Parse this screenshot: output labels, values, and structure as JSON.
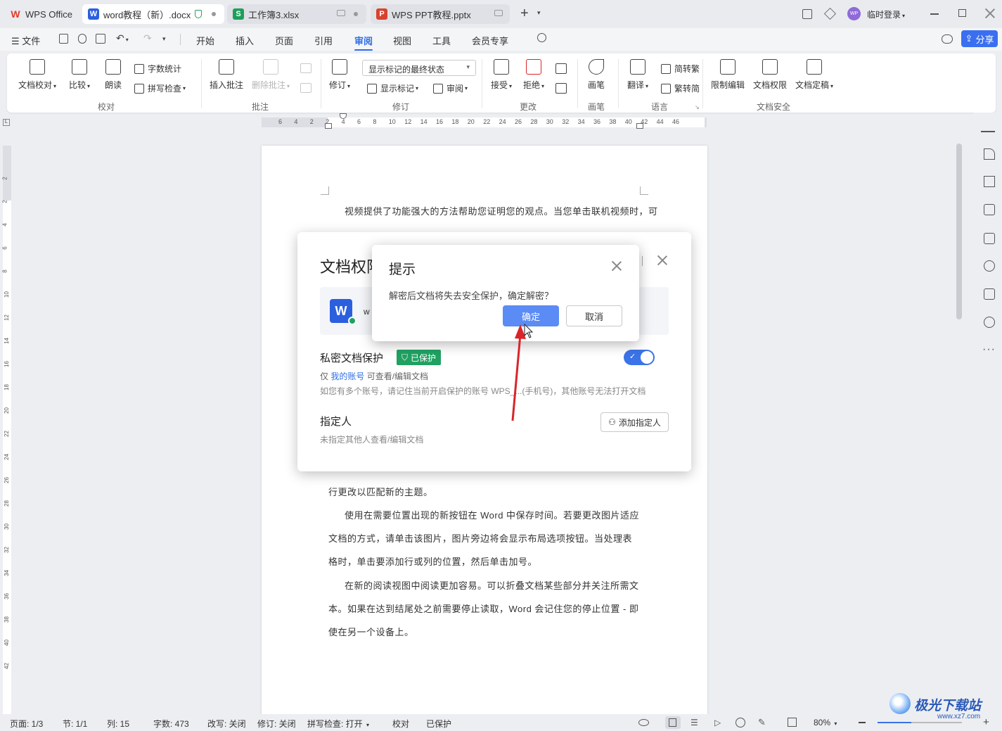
{
  "tabs": [
    {
      "label": "WPS Office",
      "icon": "wps-logo-icon"
    },
    {
      "label": "word教程（新）.docx",
      "icon": "word-doc-icon"
    },
    {
      "label": "工作簿3.xlsx",
      "icon": "sheet-icon"
    },
    {
      "label": "WPS PPT教程.pptx",
      "icon": "ppt-icon"
    }
  ],
  "titlebar": {
    "login_label": "临时登录",
    "avatar_text": "WP"
  },
  "menubar": {
    "file": "文件",
    "items": [
      "开始",
      "插入",
      "页面",
      "引用",
      "审阅",
      "视图",
      "工具",
      "会员专享"
    ],
    "active": "审阅",
    "share": "分享"
  },
  "ribbon": {
    "proof": {
      "doc_check": "文档校对",
      "compare": "比较",
      "read_aloud": "朗读",
      "word_count": "字数统计",
      "spell_check": "拼写检查",
      "group": "校对"
    },
    "comment": {
      "insert": "插入批注",
      "delete": "删除批注",
      "group": "批注"
    },
    "revision": {
      "display_select": "显示标记的最终状态",
      "track": "修订",
      "show_marks": "显示标记",
      "review": "审阅",
      "group": "修订"
    },
    "changes": {
      "accept": "接受",
      "reject": "拒绝",
      "group": "更改"
    },
    "pen": {
      "pen": "画笔",
      "group": "画笔"
    },
    "language": {
      "translate": "翻译",
      "to_trad": "简转繁",
      "to_simp": "繁转简",
      "group": "语言"
    },
    "security": {
      "restrict": "限制编辑",
      "permission": "文档权限",
      "finalize": "文档定稿",
      "group": "文档安全"
    }
  },
  "ruler_ticks": [
    "6",
    "4",
    "2",
    "2",
    "4",
    "6",
    "8",
    "10",
    "12",
    "14",
    "16",
    "18",
    "20",
    "22",
    "24",
    "26",
    "28",
    "30",
    "32",
    "34",
    "36",
    "38",
    "40",
    "42",
    "44",
    "46"
  ],
  "vruler_ticks": [
    "2",
    "2",
    "4",
    "6",
    "8",
    "10",
    "12",
    "14",
    "16",
    "18",
    "20",
    "22",
    "24",
    "26",
    "28",
    "30",
    "32",
    "34",
    "36",
    "38",
    "40",
    "42"
  ],
  "document": {
    "p1": "视频提供了功能强大的方法帮助您证明您的观点。当您单击联机视频时，可",
    "p2_tail": "行更改以匹配新的主题。",
    "p3": "使用在需要位置出现的新按钮在 Word 中保存时间。若要更改图片适应文档的方式，请单击该图片，图片旁边将会显示布局选项按钮。当处理表格时，单击要添加行或列的位置，然后单击加号。",
    "p4": "在新的阅读视图中阅读更加容易。可以折叠文档某些部分并关注所需文本。如果在达到结尾处之前需要停止读取，Word 会记住您的停止位置 - 即使在另一个设备上。"
  },
  "permission_dialog": {
    "title": "文档权限",
    "file_initial": "W",
    "private_label": "私密文档保护",
    "protected_badge": "已保护",
    "only_prefix": "仅",
    "my_account": "我的账号",
    "only_suffix": "可查看/编辑文档",
    "multi_account_note": "如您有多个账号，请记住当前开启保护的账号 WPS_...(手机号)，其他账号无法打开文档",
    "assignee_label": "指定人",
    "assignee_note": "未指定其他人查看/编辑文档",
    "add_assignee": "添加指定人",
    "toggle_on": true
  },
  "prompt_dialog": {
    "title": "提示",
    "message": "解密后文档将失去安全保护，确定解密？",
    "ok": "确定",
    "cancel": "取消"
  },
  "statusbar": {
    "page": "页面: 1/3",
    "section": "节: 1/1",
    "column": "列: 15",
    "word_count": "字数: 473",
    "overtype": "改写: 关闭",
    "revision": "修订: 关闭",
    "spell": "拼写检查: 打开",
    "proof": "校对",
    "protected": "已保护",
    "zoom": "80%"
  },
  "watermark": {
    "text": "极光下载站",
    "url": "www.xz7.com"
  },
  "colors": {
    "accent": "#2f6fe4",
    "ok_button": "#5b8cf5",
    "badge_green": "#20a162",
    "arrow_red": "#d9252a",
    "toggle": "#3b73e8"
  }
}
